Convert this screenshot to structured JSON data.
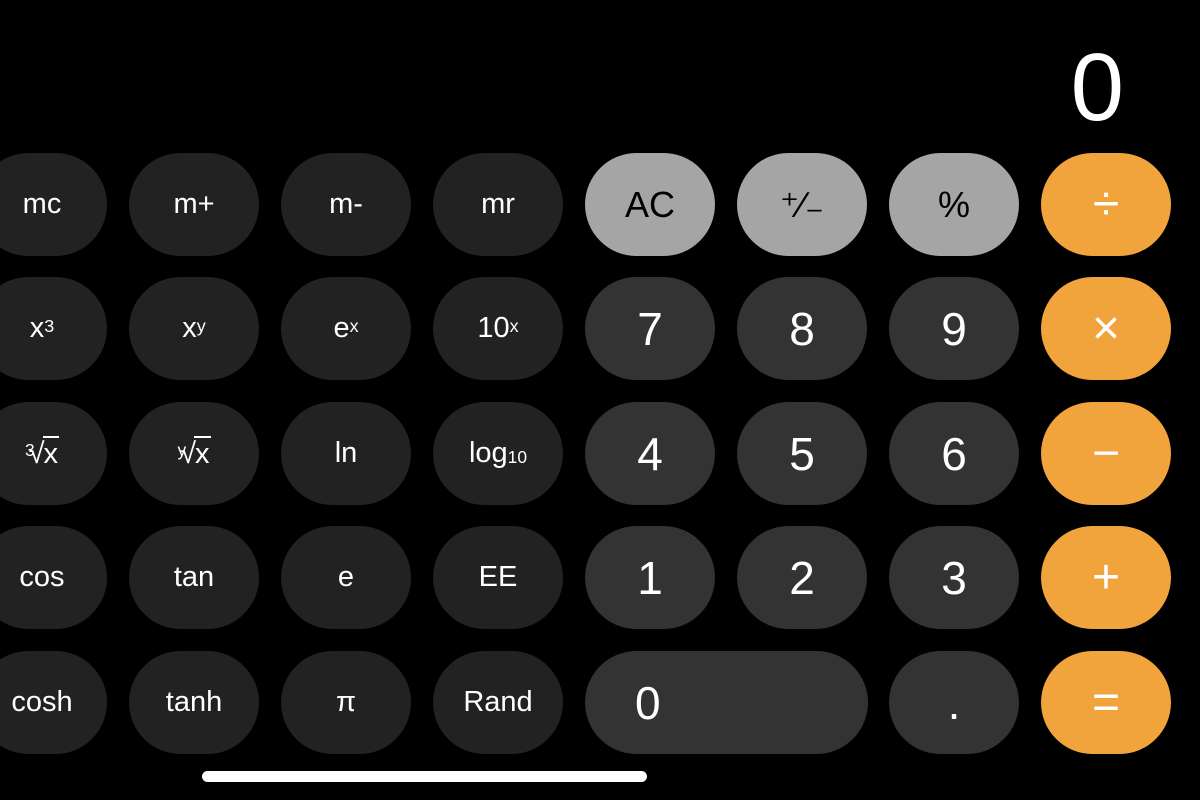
{
  "display": {
    "value": "0"
  },
  "colors": {
    "background": "#000000",
    "scientific_key": "#222222",
    "digit_key": "#333333",
    "function_key": "#a5a5a5",
    "operator_key": "#f1a33c"
  },
  "rows": [
    [
      {
        "id": "mc",
        "label": "mc",
        "kind": "sci"
      },
      {
        "id": "m-plus",
        "label": "m+",
        "kind": "sci"
      },
      {
        "id": "m-minus",
        "label": "m-",
        "kind": "sci"
      },
      {
        "id": "mr",
        "label": "mr",
        "kind": "sci"
      },
      {
        "id": "all-clear",
        "label": "AC",
        "kind": "func"
      },
      {
        "id": "plus-minus",
        "label": "⁺∕₋",
        "kind": "func"
      },
      {
        "id": "percent",
        "label": "%",
        "kind": "func"
      },
      {
        "id": "divide",
        "label": "÷",
        "kind": "op"
      }
    ],
    [
      {
        "id": "x-cubed",
        "base": "x",
        "sup": "3",
        "kind": "sci"
      },
      {
        "id": "x-to-y",
        "base": "x",
        "sup": "y",
        "kind": "sci"
      },
      {
        "id": "e-to-x",
        "base": "e",
        "sup": "x",
        "kind": "sci"
      },
      {
        "id": "ten-to-x",
        "base": "10",
        "sup": "x",
        "kind": "sci"
      },
      {
        "id": "seven",
        "label": "7",
        "kind": "digit"
      },
      {
        "id": "eight",
        "label": "8",
        "kind": "digit"
      },
      {
        "id": "nine",
        "label": "9",
        "kind": "digit"
      },
      {
        "id": "multiply",
        "label": "×",
        "kind": "op"
      }
    ],
    [
      {
        "id": "cube-root",
        "index": "3",
        "radicand": "x",
        "kind": "sci"
      },
      {
        "id": "y-root",
        "index": "y",
        "radicand": "x",
        "kind": "sci"
      },
      {
        "id": "ln",
        "label": "ln",
        "kind": "sci"
      },
      {
        "id": "log10",
        "base": "log",
        "sub": "10",
        "kind": "sci"
      },
      {
        "id": "four",
        "label": "4",
        "kind": "digit"
      },
      {
        "id": "five",
        "label": "5",
        "kind": "digit"
      },
      {
        "id": "six",
        "label": "6",
        "kind": "digit"
      },
      {
        "id": "subtract",
        "label": "−",
        "kind": "op"
      }
    ],
    [
      {
        "id": "cos",
        "label": "cos",
        "kind": "sci"
      },
      {
        "id": "tan",
        "label": "tan",
        "kind": "sci"
      },
      {
        "id": "e",
        "label": "e",
        "kind": "sci"
      },
      {
        "id": "ee",
        "label": "EE",
        "kind": "sci"
      },
      {
        "id": "one",
        "label": "1",
        "kind": "digit"
      },
      {
        "id": "two",
        "label": "2",
        "kind": "digit"
      },
      {
        "id": "three",
        "label": "3",
        "kind": "digit"
      },
      {
        "id": "add",
        "label": "+",
        "kind": "op"
      }
    ],
    [
      {
        "id": "cosh",
        "label": "cosh",
        "kind": "sci"
      },
      {
        "id": "tanh",
        "label": "tanh",
        "kind": "sci"
      },
      {
        "id": "pi",
        "label": "π",
        "kind": "sci"
      },
      {
        "id": "rand",
        "label": "Rand",
        "kind": "sci"
      },
      {
        "id": "zero",
        "label": "0",
        "kind": "digit",
        "wide": true
      },
      {
        "id": "decimal",
        "label": ".",
        "kind": "digit"
      },
      {
        "id": "equals",
        "label": "=",
        "kind": "op"
      }
    ]
  ]
}
